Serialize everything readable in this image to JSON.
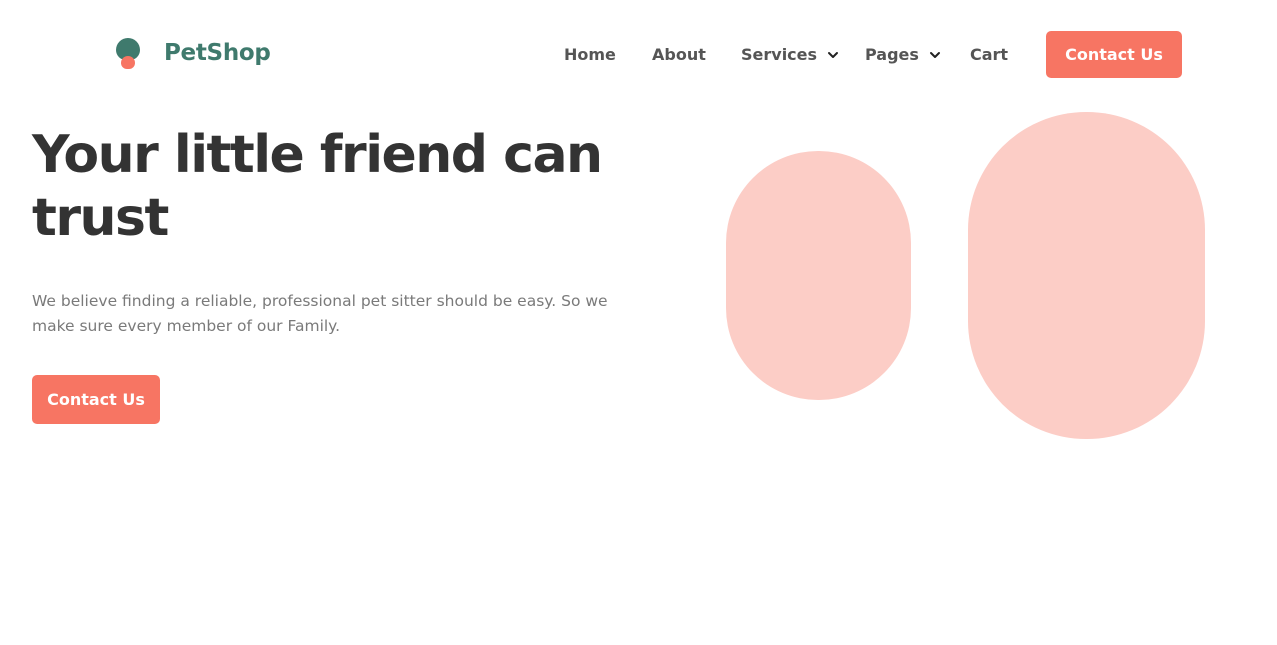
{
  "brand": {
    "name": "PetShop",
    "logo_icon": "pet-paw-logo-icon",
    "colors": {
      "primary": "#3f7a6d",
      "accent": "#f77563",
      "accent_light": "#fccdc6",
      "heading": "#333333",
      "nav_text": "#555555",
      "body_text": "#7a7a7a"
    }
  },
  "nav": {
    "items": [
      {
        "label": "Home"
      },
      {
        "label": "About"
      },
      {
        "label": "Services",
        "icon": "chevron-down-icon"
      },
      {
        "label": "Pages",
        "icon": "chevron-down-icon"
      },
      {
        "label": "Cart"
      }
    ],
    "cta_label": "Contact Us"
  },
  "hero": {
    "title": "Your little friend can trust",
    "description": "We believe finding a reliable, professional pet sitter should be easy. So we make sure every member of our Family.",
    "cta_label": "Contact Us"
  }
}
